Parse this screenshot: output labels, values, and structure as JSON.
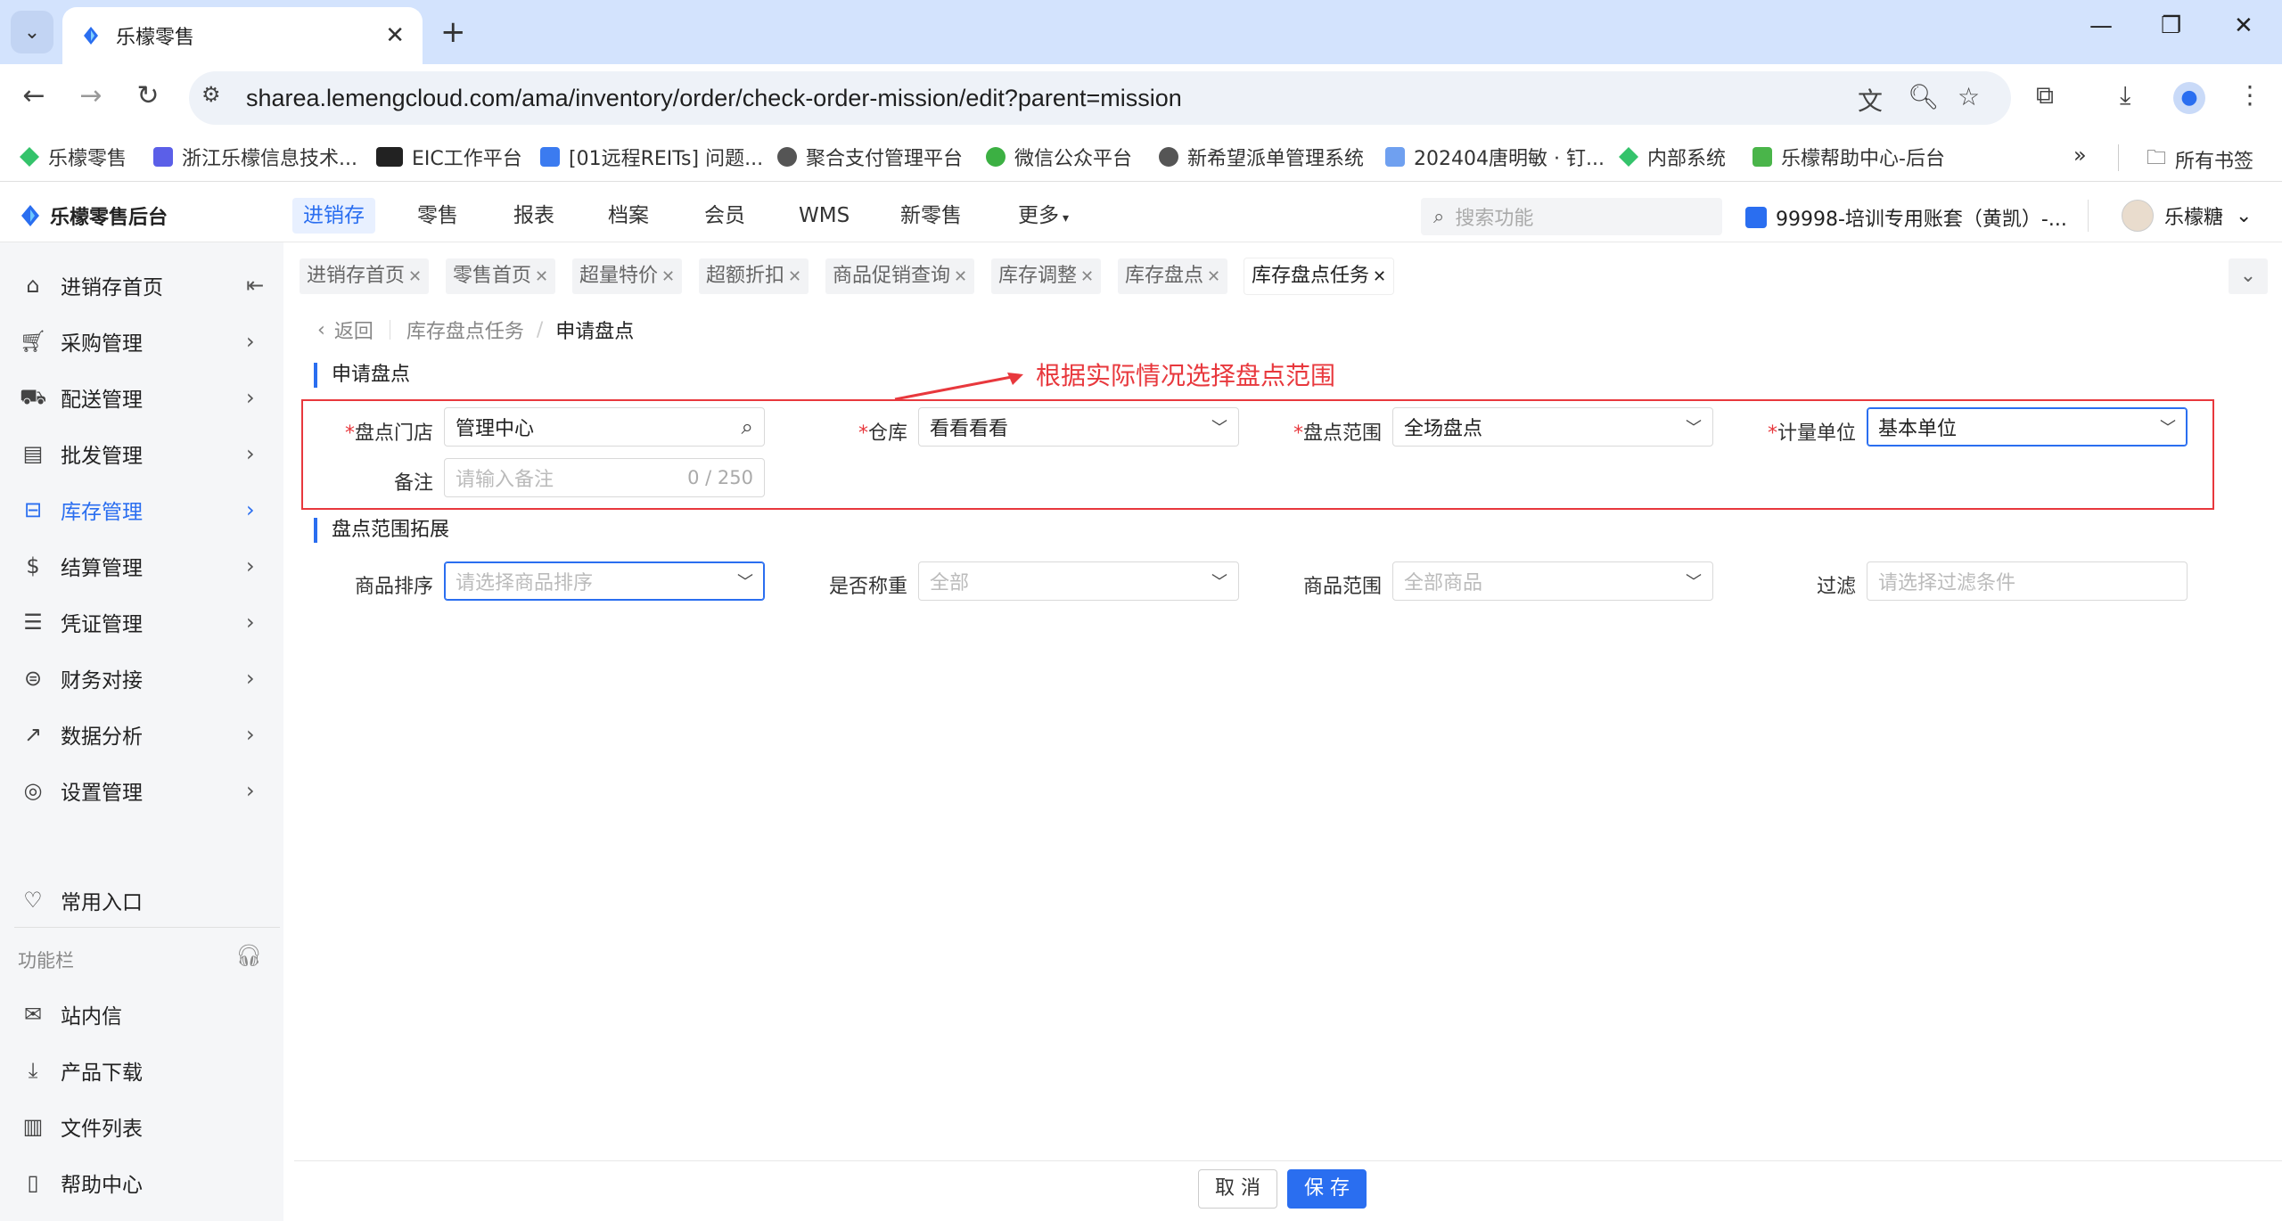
{
  "browser": {
    "tab_title": "乐檬零售",
    "url": "sharea.lemengcloud.com/ama/inventory/order/check-order-mission/edit?parent=mission",
    "bookmarks": [
      "乐檬零售",
      "浙江乐檬信息技术...",
      "EIC工作平台",
      "[01远程REITs] 问题...",
      "聚合支付管理平台",
      "微信公众平台",
      "新希望派单管理系统",
      "202404唐明敏 · 钉...",
      "内部系统",
      "乐檬帮助中心-后台"
    ],
    "all_bookmarks": "所有书签",
    "more": "»"
  },
  "header": {
    "logo": "乐檬零售后台",
    "nav": [
      "进销存",
      "零售",
      "报表",
      "档案",
      "会员",
      "WMS",
      "新零售",
      "更多"
    ],
    "search_placeholder": "搜索功能",
    "account": "99998-培训专用账套（黄凯）-...",
    "user": "乐檬糖"
  },
  "sidebar": {
    "items": [
      {
        "label": "进销存首页",
        "icon": "home-icon"
      },
      {
        "label": "采购管理",
        "icon": "cart-icon"
      },
      {
        "label": "配送管理",
        "icon": "delivery-icon"
      },
      {
        "label": "批发管理",
        "icon": "wholesale-icon"
      },
      {
        "label": "库存管理",
        "icon": "inventory-icon"
      },
      {
        "label": "结算管理",
        "icon": "settlement-icon"
      },
      {
        "label": "凭证管理",
        "icon": "voucher-icon"
      },
      {
        "label": "财务对接",
        "icon": "finance-icon"
      },
      {
        "label": "数据分析",
        "icon": "chart-icon"
      },
      {
        "label": "设置管理",
        "icon": "settings-icon"
      }
    ],
    "favorites": "常用入口",
    "function_bar": "功能栏",
    "tools": [
      "站内信",
      "产品下载",
      "文件列表",
      "帮助中心"
    ]
  },
  "page_tabs": [
    "进销存首页",
    "零售首页",
    "超量特价",
    "超额折扣",
    "商品促销查询",
    "库存调整",
    "库存盘点",
    "库存盘点任务"
  ],
  "breadcrumb": {
    "back": "返回",
    "parent": "库存盘点任务",
    "separator": "/",
    "current": "申请盘点"
  },
  "form": {
    "section1_title": "申请盘点",
    "annotation": "根据实际情况选择盘点范围",
    "store_label": "盘点门店",
    "store_value": "管理中心",
    "warehouse_label": "仓库",
    "warehouse_value": "看看看看",
    "scope_label": "盘点范围",
    "scope_value": "全场盘点",
    "unit_label": "计量单位",
    "unit_value": "基本单位",
    "remark_label": "备注",
    "remark_placeholder": "请输入备注",
    "remark_count": "0 / 250",
    "section2_title": "盘点范围拓展",
    "sort_label": "商品排序",
    "sort_placeholder": "请选择商品排序",
    "weigh_label": "是否称重",
    "weigh_placeholder": "全部",
    "product_scope_label": "商品范围",
    "product_scope_placeholder": "全部商品",
    "filter_label": "过滤",
    "filter_placeholder": "请选择过滤条件"
  },
  "footer": {
    "cancel": "取 消",
    "save": "保 存"
  },
  "colors": {
    "accent": "#2a6ef0",
    "annotation": "#e8383d"
  }
}
